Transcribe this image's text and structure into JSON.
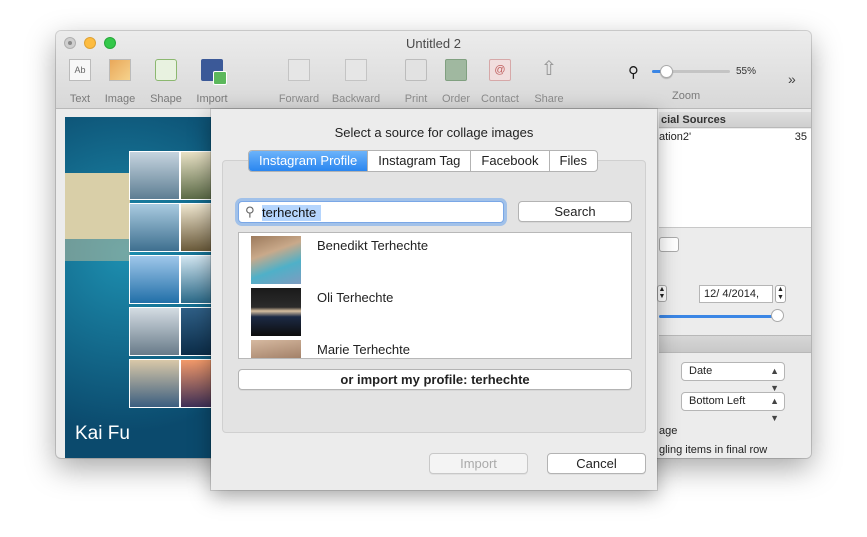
{
  "window": {
    "title": "Untitled 2"
  },
  "toolbar": {
    "items": [
      {
        "label": "Text",
        "icon": "text-icon"
      },
      {
        "label": "Image",
        "icon": "image-icon"
      },
      {
        "label": "Shape",
        "icon": "shape-icon"
      },
      {
        "label": "Import",
        "icon": "import-icon"
      },
      {
        "label": "Forward",
        "icon": "forward-icon"
      },
      {
        "label": "Backward",
        "icon": "backward-icon"
      },
      {
        "label": "Print",
        "icon": "print-icon"
      },
      {
        "label": "Order",
        "icon": "order-icon"
      },
      {
        "label": "Contact",
        "icon": "contact-icon"
      },
      {
        "label": "Share",
        "icon": "share-icon"
      }
    ],
    "zoom": {
      "label": "Zoom",
      "percent_text": "55%",
      "value": 0.18
    },
    "overflow": "»",
    "text_icon_glyph": "Ab",
    "contact_icon_glyph": "@",
    "share_icon_glyph": "⇧"
  },
  "canvas": {
    "name": "Kai Fu"
  },
  "right_panel": {
    "header": "cial Sources",
    "list_item": "ation2'",
    "list_count": "35",
    "date_value": "12/  4/2014,",
    "sort_select": "Date",
    "position_select": "Bottom Left",
    "text_1": "age",
    "text_2": "gling items in final row"
  },
  "dialog": {
    "title": "Select a source for collage images",
    "tabs": [
      "Instagram Profile",
      "Instagram Tag",
      "Facebook",
      "Files"
    ],
    "active_tab": 0,
    "search": {
      "value": "terhechte",
      "button": "Search"
    },
    "results": [
      {
        "name": "Benedikt Terhechte"
      },
      {
        "name": "Oli Terhechte"
      },
      {
        "name": "Marie Terhechte"
      }
    ],
    "import_profile_button": "or import my profile: terhechte",
    "import_button": "Import",
    "cancel_button": "Cancel"
  },
  "colors": {
    "accent": "#2a86f0",
    "canvas_bg": "#0b4a6d",
    "beige": "#d9cfa8"
  }
}
